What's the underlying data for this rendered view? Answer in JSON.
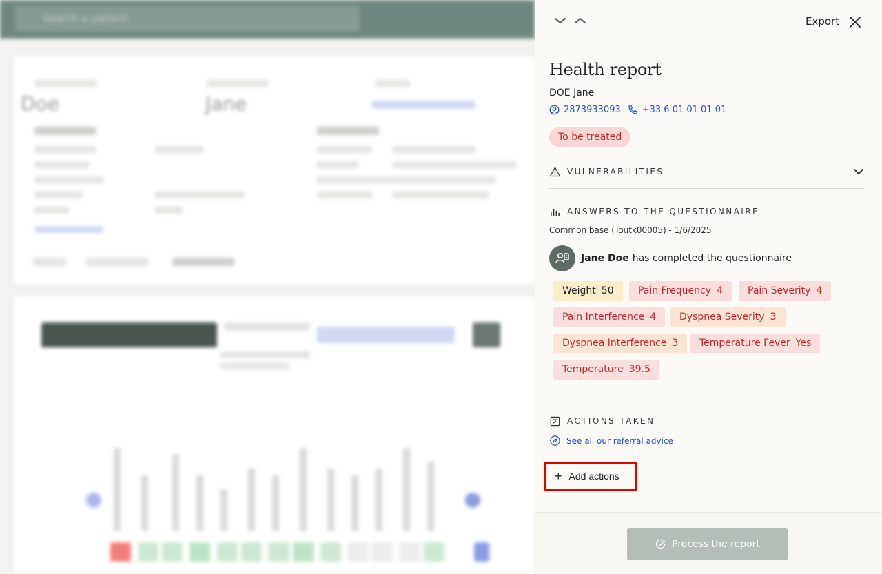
{
  "background": {
    "search_placeholder": "Search a patient",
    "patient_last_name": "Doe",
    "patient_first_name": "Jane"
  },
  "header": {
    "export_label": "Export",
    "nav_down_icon": "chevron-down-icon",
    "nav_up_icon": "chevron-up-icon",
    "close_icon": "close-icon"
  },
  "report": {
    "title": "Health report",
    "patient_name": "DOE Jane",
    "patient_id": "2873933093",
    "phone": "+33 6 01 01 01 01",
    "status": "To be treated"
  },
  "sections": {
    "vulnerabilities": "VULNERABILITIES",
    "answers": "ANSWERS TO THE QUESTIONNAIRE",
    "actions": "ACTIONS TAKEN"
  },
  "questionnaire": {
    "meta": "Common base (Toutk00005) - 1/6/2025",
    "respondent": "Jane Doe",
    "completed_text": "has completed the questionnaire",
    "tags": [
      {
        "label": "Weight",
        "value": "50",
        "tone": "yellow"
      },
      {
        "label": "Pain Frequency",
        "value": "4",
        "tone": "red"
      },
      {
        "label": "Pain Severity",
        "value": "4",
        "tone": "red"
      },
      {
        "label": "Pain Interference",
        "value": "4",
        "tone": "red"
      },
      {
        "label": "Dyspnea Severity",
        "value": "3",
        "tone": "orange"
      },
      {
        "label": "Dyspnea Interference",
        "value": "3",
        "tone": "orange"
      },
      {
        "label": "Temperature Fever",
        "value": "Yes",
        "tone": "red"
      },
      {
        "label": "Temperature",
        "value": "39.5",
        "tone": "red"
      }
    ]
  },
  "actions": {
    "referral_link": "See all our referral advice",
    "add_label": "Add actions"
  },
  "footer": {
    "process_label": "Process the report"
  },
  "colors": {
    "accent_blue": "#2553c9",
    "danger": "#c42b2b",
    "highlight_box": "#e50000"
  }
}
